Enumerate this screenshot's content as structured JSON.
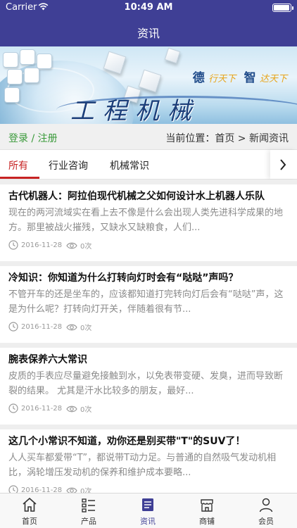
{
  "status_bar": {
    "carrier": "Carrier",
    "time": "10:49 AM"
  },
  "nav": {
    "title": "资讯"
  },
  "banner": {
    "headline": "工程机械",
    "motto": {
      "char1": "德",
      "phrase1": "行天下",
      "char2": "智",
      "phrase2": "达天下"
    }
  },
  "login_bar": {
    "login_text": "登录 / 注册",
    "location_text": "当前位置：首页 > 新闻资讯"
  },
  "tabs": [
    {
      "label": "所有",
      "active": true
    },
    {
      "label": "行业咨询",
      "active": false
    },
    {
      "label": "机械常识",
      "active": false
    }
  ],
  "articles": [
    {
      "title": "古代机器人：阿拉伯现代机械之父如何设计水上机器人乐队",
      "summary": "现在的两河流域实在看上去不像是什么会出现人类先进科学成果的地方。那里被战火摧残，又缺水又缺粮食，人们...",
      "date": "2016-11-28",
      "views": "0次"
    },
    {
      "title": "冷知识：你知道为什么打转向灯时会有“哒哒”声吗？",
      "summary": "不管开车的还是坐车的，应该都知道打完转向灯后会有“哒哒”声，这是为什么呢？打转向灯开关，伴随着很有节...",
      "date": "2016-11-28",
      "views": "0次"
    },
    {
      "title": "腕表保养六大常识",
      "summary": "皮质的手表应尽量避免接触到水，以免表带变硬、发臭，进而导致断裂的结果。 尤其是汗水比较多的朋友，最好...",
      "date": "2016-11-28",
      "views": "0次"
    },
    {
      "title": "这几个小常识不知道，劝你还是别买带\"T\"的SUV了！",
      "summary": "人人买车都爱带“T”，都说带T动力足。与普通的自然吸气发动机相比，涡轮增压发动机的保养和维护成本要略...",
      "date": "2016-11-28",
      "views": "0次"
    }
  ],
  "tab_bar": [
    {
      "label": "首页",
      "icon": "home-icon"
    },
    {
      "label": "产品",
      "icon": "list-icon"
    },
    {
      "label": "资讯",
      "icon": "news-icon",
      "active": true
    },
    {
      "label": "商铺",
      "icon": "shop-icon"
    },
    {
      "label": "会员",
      "icon": "user-icon"
    }
  ],
  "colors": {
    "primary": "#3f3f95",
    "tab_active": "#c72323",
    "login_green": "#3a9a3a"
  }
}
